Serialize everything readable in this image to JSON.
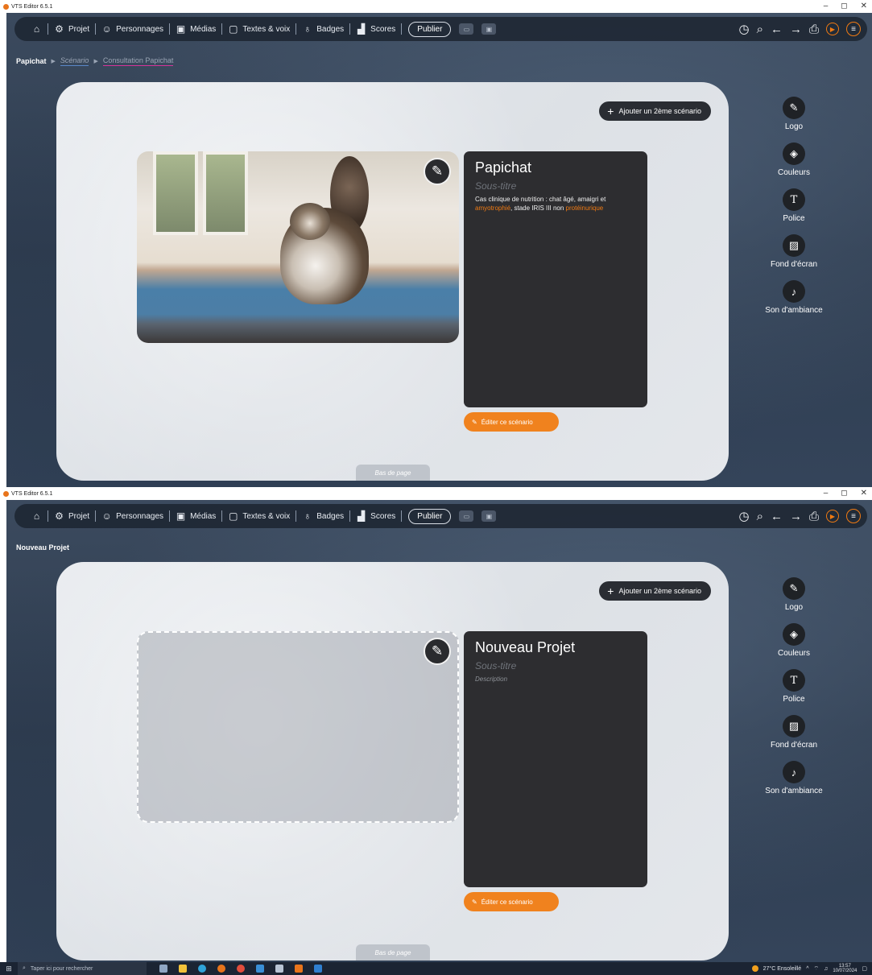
{
  "window": {
    "title": "VTS Editor 6.5.1",
    "controls": [
      "–",
      "◻",
      "✕"
    ]
  },
  "toolbar": {
    "home_icon": "home-icon",
    "items": [
      {
        "label": "Projet",
        "icon": "gear-icon"
      },
      {
        "label": "Personnages",
        "icon": "character-icon"
      },
      {
        "label": "Médias",
        "icon": "media-icon"
      },
      {
        "label": "Textes & voix",
        "icon": "speech-bubble-icon"
      },
      {
        "label": "Badges",
        "icon": "badge-icon"
      },
      {
        "label": "Scores",
        "icon": "chart-icon"
      }
    ],
    "publish_label": "Publier",
    "right_icons": [
      "timer-icon",
      "search-icon",
      "arrow-left-icon",
      "arrow-right-icon",
      "screenshot-icon",
      "play-icon",
      "menu-icon"
    ]
  },
  "screen1": {
    "breadcrumb": {
      "project": "Papichat",
      "scenario": "Scénario",
      "current": "Consultation Papichat"
    },
    "add_scenario_label": "Ajouter un 2ème scénario",
    "card": {
      "title": "Papichat",
      "subtitle": "Sous-titre",
      "desc_part1": "Cas clinique de nutrition : chat âgé, amaigri et ",
      "desc_highlight1": "amyotrophié",
      "desc_part2": ", stade IRIS III non ",
      "desc_highlight2": "protéinurique"
    },
    "edit_scenario_label": "Éditer ce scénario",
    "bas_de_page": "Bas de page"
  },
  "screen2": {
    "breadcrumb": {
      "project": "Nouveau Projet"
    },
    "add_scenario_label": "Ajouter un 2ème scénario",
    "card": {
      "title": "Nouveau Projet",
      "subtitle": "Sous-titre",
      "description": "Description"
    },
    "edit_scenario_label": "Éditer ce scénario",
    "bas_de_page": "Bas de page"
  },
  "right_tools": [
    {
      "label": "Logo",
      "icon": "edit-icon"
    },
    {
      "label": "Couleurs",
      "icon": "paint-bucket-icon"
    },
    {
      "label": "Police",
      "icon": "font-icon"
    },
    {
      "label": "Fond d'écran",
      "icon": "image-icon"
    },
    {
      "label": "Son d'ambiance",
      "icon": "music-note-icon"
    }
  ],
  "taskbar": {
    "search_placeholder": "Taper ici pour rechercher",
    "weather": "27°C  Ensoleillé",
    "time": "13:57",
    "date": "10/07/2024"
  },
  "colors": {
    "accent_orange": "#f0821e",
    "card_dark": "#2d2d30",
    "toolbar_bg": "#1c2430",
    "highlight_pink": "#d6339a",
    "highlight_blue": "#5b88c9"
  }
}
